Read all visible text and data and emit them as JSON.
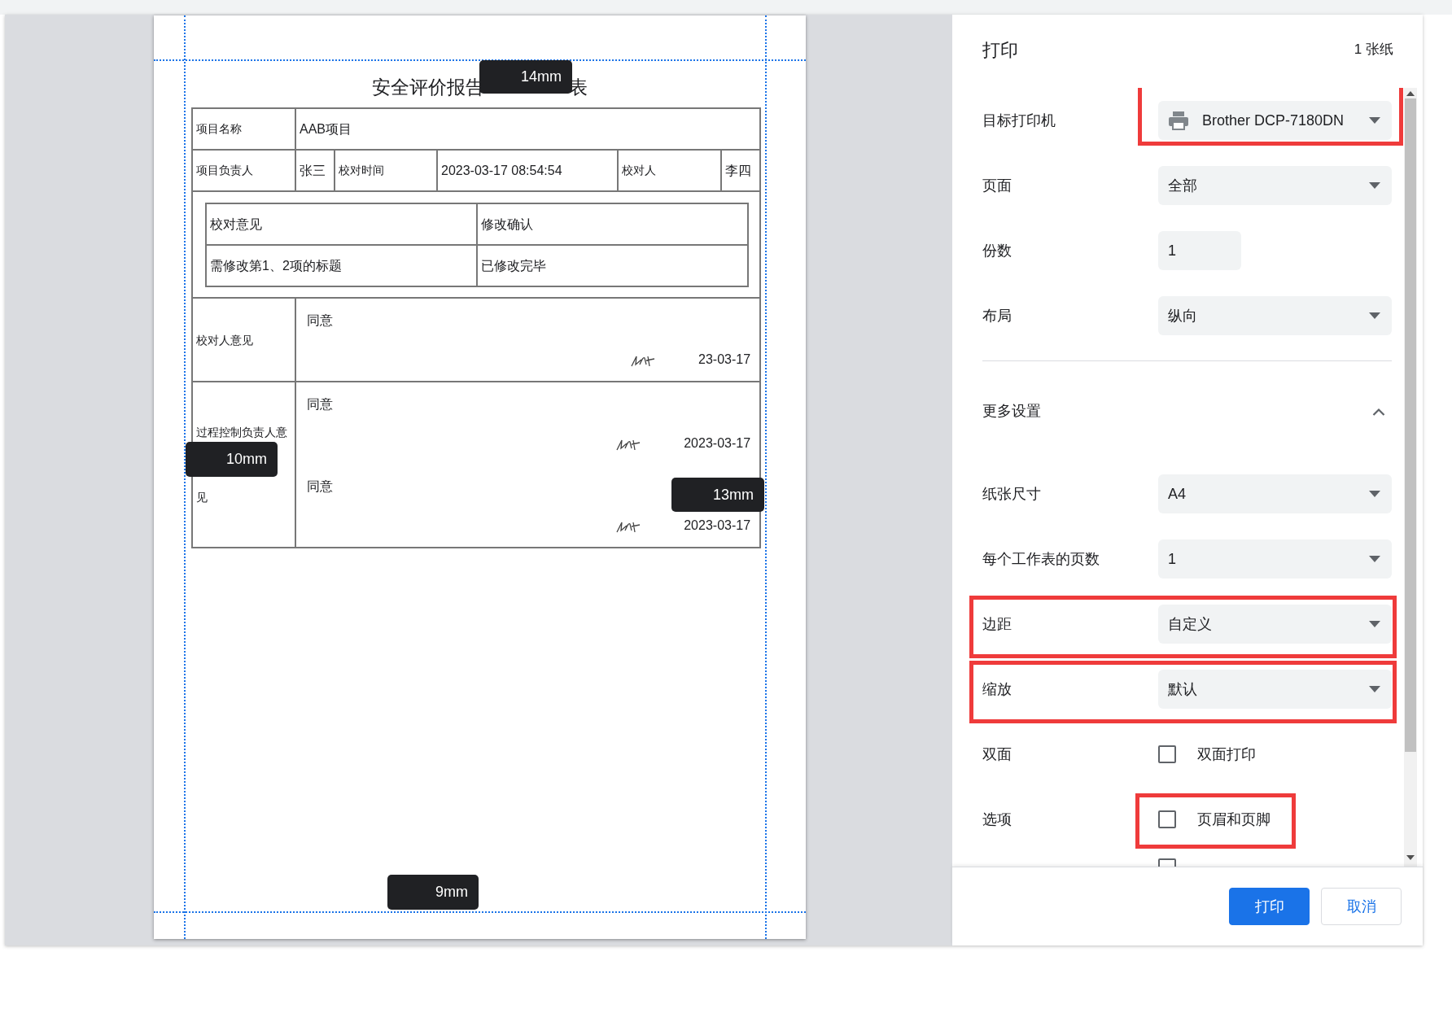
{
  "preview": {
    "document": {
      "title_parts": [
        "安全评价报告",
        "表"
      ],
      "project": {
        "label": "项目名称",
        "value": "AAB项目"
      },
      "info_row": [
        {
          "text": "项目负责人",
          "kind": "label"
        },
        {
          "text": "张三",
          "kind": "value"
        },
        {
          "text": "校对时间",
          "kind": "label"
        },
        {
          "text": "2023-03-17 08:54:54",
          "kind": "value"
        },
        {
          "text": "校对人",
          "kind": "label"
        },
        {
          "text": "李四",
          "kind": "value"
        }
      ],
      "review_table": {
        "headers": [
          "校对意见",
          "修改确认"
        ],
        "rows": [
          [
            "需修改第1、2项的标题",
            "已修改完毕"
          ]
        ]
      },
      "opinions": [
        {
          "label": "校对人意见",
          "entries": [
            {
              "text": "同意",
              "date": "23-03-17"
            }
          ]
        },
        {
          "label": "过程控制负责人意见",
          "entries": [
            {
              "text": "同意",
              "date": "2023-03-17"
            },
            {
              "text": "同意",
              "date": "2023-03-17"
            }
          ]
        }
      ]
    },
    "margin_badges": [
      {
        "text": "14mm",
        "kind": "top"
      },
      {
        "text": "10mm",
        "kind": "left"
      },
      {
        "text": "13mm",
        "kind": "right"
      },
      {
        "text": "9mm",
        "kind": "bottom"
      }
    ]
  },
  "dialog": {
    "title": "打印",
    "sheet_count": "1 张纸",
    "settings": [
      {
        "kind": "destination",
        "label": "目标打印机",
        "value": "Brother DCP-7180DN",
        "highlighted": true
      },
      {
        "kind": "select",
        "label": "页面",
        "value": "全部"
      },
      {
        "kind": "input",
        "label": "份数",
        "value": "1"
      },
      {
        "kind": "select",
        "label": "布局",
        "value": "纵向"
      },
      {
        "kind": "section",
        "label": "更多设置",
        "expanded": true
      },
      {
        "kind": "select",
        "label": "纸张尺寸",
        "value": "A4"
      },
      {
        "kind": "select",
        "label": "每个工作表的页数",
        "value": "1"
      },
      {
        "kind": "select",
        "label": "边距",
        "value": "自定义",
        "highlighted": true
      },
      {
        "kind": "select",
        "label": "缩放",
        "value": "默认",
        "highlighted": true
      },
      {
        "kind": "checkbox",
        "label": "双面",
        "option": "双面打印",
        "checked": false
      },
      {
        "kind": "checkbox",
        "label": "选项",
        "option": "页眉和页脚",
        "checked": false,
        "highlighted": true
      },
      {
        "kind": "checkbox",
        "checked": false
      }
    ],
    "buttons": [
      {
        "text": "打印",
        "kind": "primary"
      },
      {
        "text": "取消",
        "kind": "secondary"
      }
    ]
  }
}
